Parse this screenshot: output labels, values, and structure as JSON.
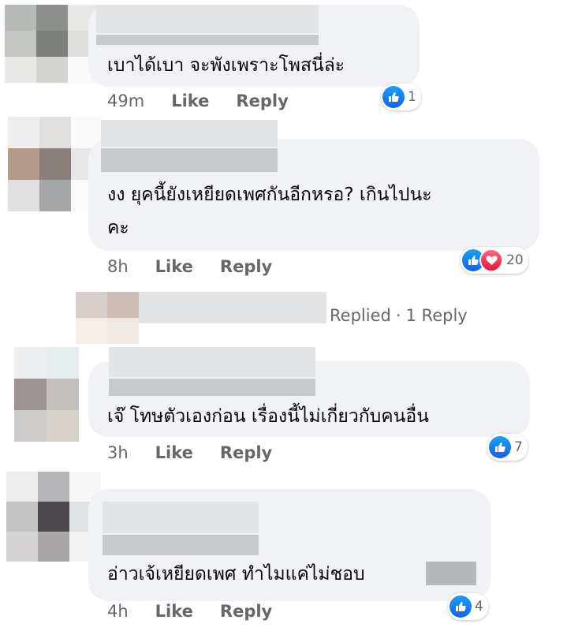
{
  "comments": [
    {
      "text_lines": [
        "เบาได้เบา จะพังเพราะโพสนี่ล่ะ"
      ],
      "time": "49m",
      "like_label": "Like",
      "reply_label": "Reply",
      "reactions": [
        "like"
      ],
      "reaction_count": "1"
    },
    {
      "text_lines": [
        "งง ยุคนี้ยังเหยียดเพศกันอีกหรอ? เกินไปนะ",
        "คะ"
      ],
      "time": "8h",
      "like_label": "Like",
      "reply_label": "Reply",
      "reactions": [
        "like",
        "love"
      ],
      "reaction_count": "20"
    },
    {
      "text_lines": [
        "เจ๊ โทษตัวเองก่อน เรื่องนี้ไม่เกี่ยวกับคนอื่น"
      ],
      "time": "3h",
      "like_label": "Like",
      "reply_label": "Reply",
      "reactions": [
        "like"
      ],
      "reaction_count": "7"
    },
    {
      "text_lines": [
        "อ่าวเจ้เหยียดเพศ ทำไมแค่ไม่ชอบ"
      ],
      "time": "4h",
      "like_label": "Like",
      "reply_label": "Reply",
      "reactions": [
        "like"
      ],
      "reaction_count": "4"
    }
  ],
  "replies_summary": {
    "replied": "Replied",
    "separator": "·",
    "count": "1 Reply"
  },
  "colors": {
    "bubble": "#f0f2f5",
    "meta": "#65676b",
    "like_blue": "#1877f2",
    "love_red": "#f33e58"
  }
}
